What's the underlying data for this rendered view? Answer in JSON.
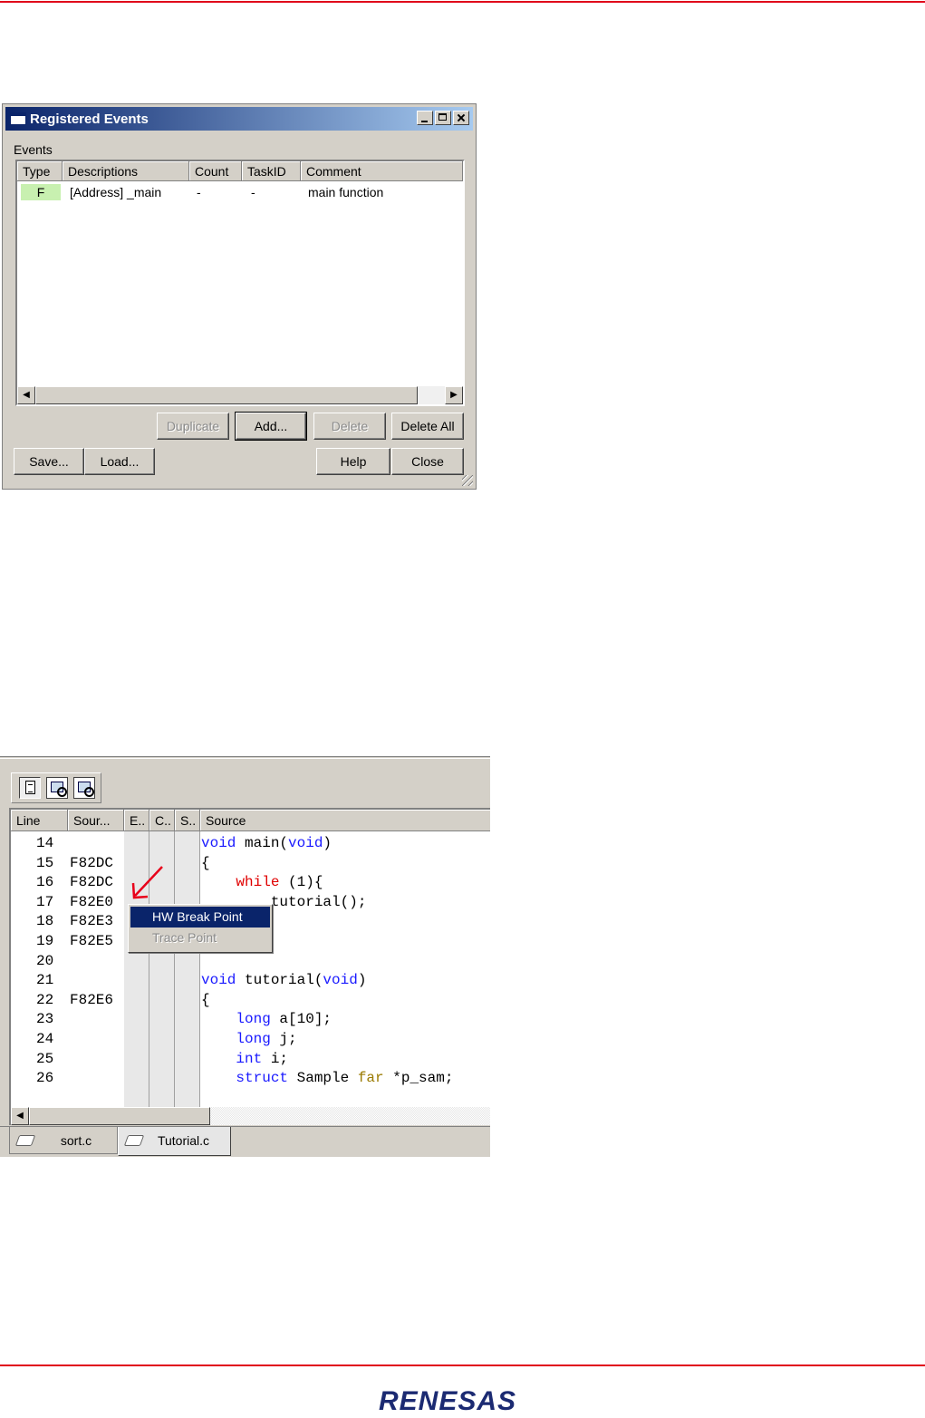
{
  "dialog": {
    "title": "Registered Events",
    "events_label": "Events",
    "columns": [
      "Type",
      "Descriptions",
      "Count",
      "TaskID",
      "Comment"
    ],
    "rows": [
      {
        "type": "F",
        "description": "[Address] _main",
        "count": "-",
        "taskid": "-",
        "comment": "main function"
      }
    ],
    "buttons": {
      "duplicate": "Duplicate",
      "add": "Add...",
      "delete": "Delete",
      "delete_all": "Delete All",
      "save": "Save...",
      "load": "Load...",
      "help": "Help",
      "close": "Close"
    },
    "type_highlight_color": "#c8f0b0"
  },
  "editor": {
    "columns": [
      "Line",
      "Sour...",
      "E..",
      "C..",
      "S..",
      "Source"
    ],
    "lines": [
      {
        "num": "14",
        "addr": "",
        "code": "void main(void)"
      },
      {
        "num": "15",
        "addr": "F82DC",
        "code": "{"
      },
      {
        "num": "16",
        "addr": "F82DC",
        "code": "    while (1){"
      },
      {
        "num": "17",
        "addr": "F82E0",
        "code": "        tutorial();"
      },
      {
        "num": "18",
        "addr": "F82E3",
        "code": ""
      },
      {
        "num": "19",
        "addr": "F82E5",
        "code": ""
      },
      {
        "num": "20",
        "addr": "",
        "code": ""
      },
      {
        "num": "21",
        "addr": "",
        "code": "void tutorial(void)"
      },
      {
        "num": "22",
        "addr": "F82E6",
        "code": "{"
      },
      {
        "num": "23",
        "addr": "",
        "code": "    long a[10];"
      },
      {
        "num": "24",
        "addr": "",
        "code": "    long j;"
      },
      {
        "num": "25",
        "addr": "",
        "code": "    int i;"
      },
      {
        "num": "26",
        "addr": "",
        "code": "    struct Sample far *p_sam;"
      }
    ],
    "context_menu": {
      "items": [
        {
          "label": "HW Break Point",
          "state": "highlighted"
        },
        {
          "label": "Trace Point",
          "state": "disabled"
        }
      ]
    },
    "tabs": [
      {
        "label": "sort.c",
        "active": false
      },
      {
        "label": "Tutorial.c",
        "active": true
      }
    ]
  },
  "footer": {
    "logo_text": "RENESAS"
  },
  "colors": {
    "rule": "#e0001a",
    "keyword_blue": "#1a1aff",
    "keyword_red": "#e00000",
    "keyword_olive": "#9a7a00",
    "logo": "#1b2a72",
    "menu_highlight": "#0a246a"
  }
}
